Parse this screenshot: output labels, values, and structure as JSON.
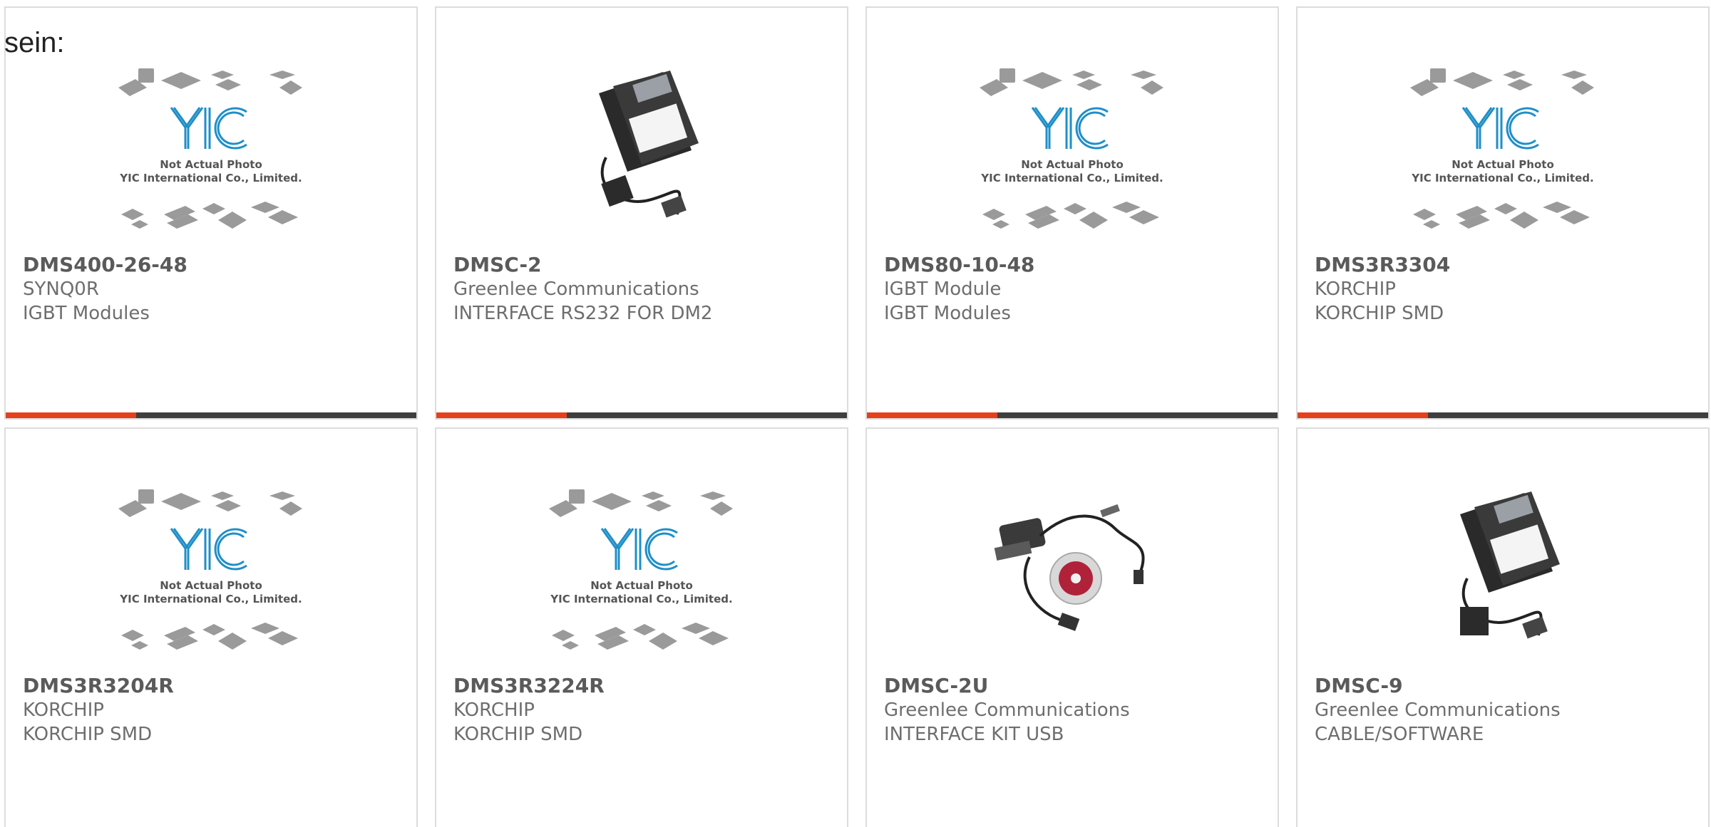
{
  "page": {
    "label": "sein:"
  },
  "colors": {
    "accent": "#e5401c",
    "bar": "#3e3e3e",
    "border": "#dcdcdc",
    "text": "#6e6e6e",
    "logo_blue": "#1f8fc8"
  },
  "placeholder": {
    "caption_line1": "Not Actual Photo",
    "caption_line2": "YIC International Co., Limited.",
    "logo_text": "YIC"
  },
  "products": [
    {
      "part": "DMS400-26-48",
      "brand": "SYNQ0R",
      "category": "IGBT Modules",
      "image": "yic-placeholder-icon"
    },
    {
      "part": "DMSC-2",
      "brand": "Greenlee Communications",
      "category": "INTERFACE RS232 FOR DM2",
      "image": "floppy-cable-icon"
    },
    {
      "part": "DMS80-10-48",
      "brand": "IGBT Module",
      "category": "IGBT Modules",
      "image": "yic-placeholder-icon"
    },
    {
      "part": "DMS3R3304",
      "brand": "KORCHIP",
      "category": "KORCHIP SMD",
      "image": "yic-placeholder-icon"
    },
    {
      "part": "DMS3R3204R",
      "brand": "KORCHIP",
      "category": "KORCHIP SMD",
      "image": "yic-placeholder-icon"
    },
    {
      "part": "DMS3R3224R",
      "brand": "KORCHIP",
      "category": "KORCHIP SMD",
      "image": "yic-placeholder-icon"
    },
    {
      "part": "DMSC-2U",
      "brand": "Greenlee Communications",
      "category": "INTERFACE KIT USB",
      "image": "usb-kit-icon"
    },
    {
      "part": "DMSC-9",
      "brand": "Greenlee Communications",
      "category": "CABLE/SOFTWARE",
      "image": "floppy-cable-icon"
    }
  ]
}
